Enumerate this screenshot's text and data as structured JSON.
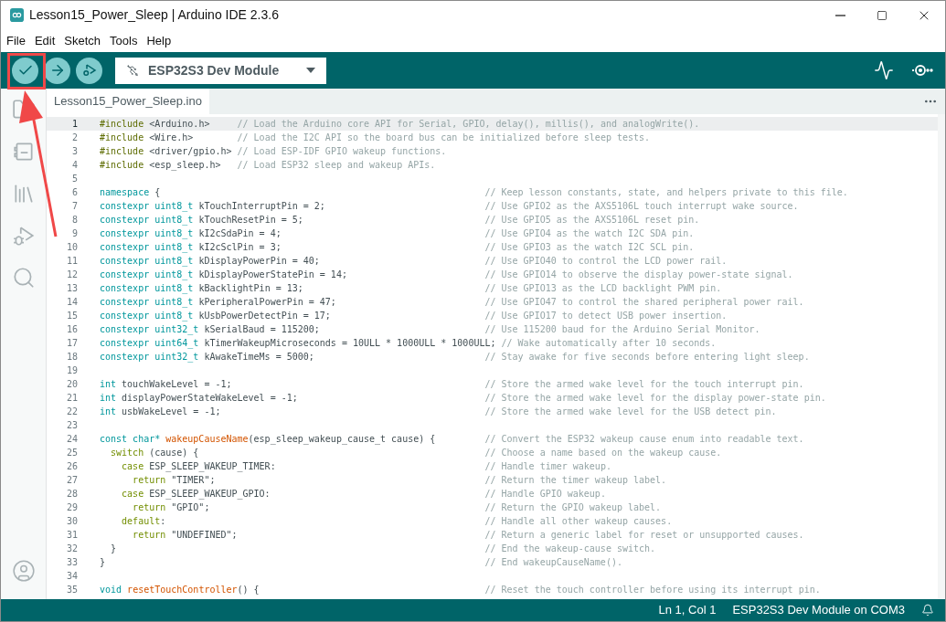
{
  "window": {
    "title": "Lesson15_Power_Sleep | Arduino IDE 2.3.6"
  },
  "menu": [
    "File",
    "Edit",
    "Sketch",
    "Tools",
    "Help"
  ],
  "toolbar": {
    "board": "ESP32S3 Dev Module"
  },
  "tabs": [
    {
      "label": "Lesson15_Power_Sleep.ino",
      "selected": true
    }
  ],
  "editor": {
    "lines": [
      {
        "n": "1",
        "current": true,
        "tokens": [
          {
            "kind": "pre",
            "text": "#include"
          },
          {
            "kind": "txt",
            "text": " <Arduino.h>     "
          },
          {
            "kind": "cmt",
            "text": "// Load the Arduino core API for Serial, GPIO, delay(), millis(), and analogWrite()."
          }
        ]
      },
      {
        "n": "2",
        "current": false,
        "tokens": [
          {
            "kind": "pre",
            "text": "#include"
          },
          {
            "kind": "txt",
            "text": " <Wire.h>        "
          },
          {
            "kind": "cmt",
            "text": "// Load the I2C API so the board bus can be initialized before sleep tests."
          }
        ]
      },
      {
        "n": "3",
        "current": false,
        "tokens": [
          {
            "kind": "pre",
            "text": "#include"
          },
          {
            "kind": "txt",
            "text": " <driver/gpio.h> "
          },
          {
            "kind": "cmt",
            "text": "// Load ESP-IDF GPIO wakeup functions."
          }
        ]
      },
      {
        "n": "4",
        "current": false,
        "tokens": [
          {
            "kind": "pre",
            "text": "#include"
          },
          {
            "kind": "txt",
            "text": " <esp_sleep.h>   "
          },
          {
            "kind": "cmt",
            "text": "// Load ESP32 sleep and wakeup APIs."
          }
        ]
      },
      {
        "n": "5",
        "current": false
      },
      {
        "n": "6",
        "current": false,
        "tokens": [
          {
            "kind": "kw",
            "text": "namespace"
          },
          {
            "kind": "txt",
            "text": " {                                                           "
          },
          {
            "kind": "cmt",
            "text": "// Keep lesson constants, state, and helpers private to this file."
          }
        ]
      },
      {
        "n": "7",
        "current": false,
        "tokens": [
          {
            "kind": "kw",
            "text": "constexpr uint8_t"
          },
          {
            "kind": "txt",
            "text": " kTouchInterruptPin = 2;                             "
          },
          {
            "kind": "cmt",
            "text": "// Use GPIO2 as the AXS5106L touch interrupt wake source."
          }
        ]
      },
      {
        "n": "8",
        "current": false,
        "tokens": [
          {
            "kind": "kw",
            "text": "constexpr uint8_t"
          },
          {
            "kind": "txt",
            "text": " kTouchResetPin = 5;                                 "
          },
          {
            "kind": "cmt",
            "text": "// Use GPIO5 as the AXS5106L reset pin."
          }
        ]
      },
      {
        "n": "9",
        "current": false,
        "tokens": [
          {
            "kind": "kw",
            "text": "constexpr uint8_t"
          },
          {
            "kind": "txt",
            "text": " kI2cSdaPin = 4;                                     "
          },
          {
            "kind": "cmt",
            "text": "// Use GPIO4 as the watch I2C SDA pin."
          }
        ]
      },
      {
        "n": "10",
        "current": false,
        "tokens": [
          {
            "kind": "kw",
            "text": "constexpr uint8_t"
          },
          {
            "kind": "txt",
            "text": " kI2cSclPin = 3;                                     "
          },
          {
            "kind": "cmt",
            "text": "// Use GPIO3 as the watch I2C SCL pin."
          }
        ]
      },
      {
        "n": "11",
        "current": false,
        "tokens": [
          {
            "kind": "kw",
            "text": "constexpr uint8_t"
          },
          {
            "kind": "txt",
            "text": " kDisplayPowerPin = 40;                              "
          },
          {
            "kind": "cmt",
            "text": "// Use GPIO40 to control the LCD power rail."
          }
        ]
      },
      {
        "n": "12",
        "current": false,
        "tokens": [
          {
            "kind": "kw",
            "text": "constexpr uint8_t"
          },
          {
            "kind": "txt",
            "text": " kDisplayPowerStatePin = 14;                         "
          },
          {
            "kind": "cmt",
            "text": "// Use GPIO14 to observe the display power-state signal."
          }
        ]
      },
      {
        "n": "13",
        "current": false,
        "tokens": [
          {
            "kind": "kw",
            "text": "constexpr uint8_t"
          },
          {
            "kind": "txt",
            "text": " kBacklightPin = 13;                                 "
          },
          {
            "kind": "cmt",
            "text": "// Use GPIO13 as the LCD backlight PWM pin."
          }
        ]
      },
      {
        "n": "14",
        "current": false,
        "tokens": [
          {
            "kind": "kw",
            "text": "constexpr uint8_t"
          },
          {
            "kind": "txt",
            "text": " kPeripheralPowerPin = 47;                           "
          },
          {
            "kind": "cmt",
            "text": "// Use GPIO47 to control the shared peripheral power rail."
          }
        ]
      },
      {
        "n": "15",
        "current": false,
        "tokens": [
          {
            "kind": "kw",
            "text": "constexpr uint8_t"
          },
          {
            "kind": "txt",
            "text": " kUsbPowerDetectPin = 17;                            "
          },
          {
            "kind": "cmt",
            "text": "// Use GPIO17 to detect USB power insertion."
          }
        ]
      },
      {
        "n": "16",
        "current": false,
        "tokens": [
          {
            "kind": "kw",
            "text": "constexpr uint32_t"
          },
          {
            "kind": "txt",
            "text": " kSerialBaud = 115200;                              "
          },
          {
            "kind": "cmt",
            "text": "// Use 115200 baud for the Arduino Serial Monitor."
          }
        ]
      },
      {
        "n": "17",
        "current": false,
        "tokens": [
          {
            "kind": "kw",
            "text": "constexpr uint64_t"
          },
          {
            "kind": "txt",
            "text": " kTimerWakeupMicroseconds = 10ULL * 1000ULL * 1000ULL; "
          },
          {
            "kind": "cmt",
            "text": "// Wake automatically after 10 seconds."
          }
        ]
      },
      {
        "n": "18",
        "current": false,
        "tokens": [
          {
            "kind": "kw",
            "text": "constexpr uint32_t"
          },
          {
            "kind": "txt",
            "text": " kAwakeTimeMs = 5000;                               "
          },
          {
            "kind": "cmt",
            "text": "// Stay awake for five seconds before entering light sleep."
          }
        ]
      },
      {
        "n": "19",
        "current": false
      },
      {
        "n": "20",
        "current": false,
        "tokens": [
          {
            "kind": "kw",
            "text": "int"
          },
          {
            "kind": "txt",
            "text": " touchWakeLevel = -1;                                              "
          },
          {
            "kind": "cmt",
            "text": "// Store the armed wake level for the touch interrupt pin."
          }
        ]
      },
      {
        "n": "21",
        "current": false,
        "tokens": [
          {
            "kind": "kw",
            "text": "int"
          },
          {
            "kind": "txt",
            "text": " displayPowerStateWakeLevel = -1;                                  "
          },
          {
            "kind": "cmt",
            "text": "// Store the armed wake level for the display power-state pin."
          }
        ]
      },
      {
        "n": "22",
        "current": false,
        "tokens": [
          {
            "kind": "kw",
            "text": "int"
          },
          {
            "kind": "txt",
            "text": " usbWakeLevel = -1;                                                "
          },
          {
            "kind": "cmt",
            "text": "// Store the armed wake level for the USB detect pin."
          }
        ]
      },
      {
        "n": "23",
        "current": false
      },
      {
        "n": "24",
        "current": false,
        "tokens": [
          {
            "kind": "kw",
            "text": "const char* "
          },
          {
            "kind": "fn",
            "text": "wakeupCauseName"
          },
          {
            "kind": "txt",
            "text": "(esp_sleep_wakeup_cause_t cause) {         "
          },
          {
            "kind": "cmt",
            "text": "// Convert the ESP32 wakeup cause enum into readable text."
          }
        ]
      },
      {
        "n": "25",
        "current": false,
        "tokens": [
          {
            "kind": "ctl",
            "text": "  switch"
          },
          {
            "kind": "txt",
            "text": " (cause) {                                                    "
          },
          {
            "kind": "cmt",
            "text": "// Choose a name based on the wakeup cause."
          }
        ]
      },
      {
        "n": "26",
        "current": false,
        "tokens": [
          {
            "kind": "ctl",
            "text": "    case"
          },
          {
            "kind": "txt",
            "text": " ESP_SLEEP_WAKEUP_TIMER:                                      "
          },
          {
            "kind": "cmt",
            "text": "// Handle timer wakeup."
          }
        ]
      },
      {
        "n": "27",
        "current": false,
        "tokens": [
          {
            "kind": "ctl",
            "text": "      return"
          },
          {
            "kind": "txt",
            "text": " \"TIMER\";                                                 "
          },
          {
            "kind": "cmt",
            "text": "// Return the timer wakeup label."
          }
        ]
      },
      {
        "n": "28",
        "current": false,
        "tokens": [
          {
            "kind": "ctl",
            "text": "    case"
          },
          {
            "kind": "txt",
            "text": " ESP_SLEEP_WAKEUP_GPIO:                                       "
          },
          {
            "kind": "cmt",
            "text": "// Handle GPIO wakeup."
          }
        ]
      },
      {
        "n": "29",
        "current": false,
        "tokens": [
          {
            "kind": "ctl",
            "text": "      return"
          },
          {
            "kind": "txt",
            "text": " \"GPIO\";                                                  "
          },
          {
            "kind": "cmt",
            "text": "// Return the GPIO wakeup label."
          }
        ]
      },
      {
        "n": "30",
        "current": false,
        "tokens": [
          {
            "kind": "ctl",
            "text": "    default"
          },
          {
            "kind": "txt",
            "text": ":                                                          "
          },
          {
            "kind": "cmt",
            "text": "// Handle all other wakeup causes."
          }
        ]
      },
      {
        "n": "31",
        "current": false,
        "tokens": [
          {
            "kind": "ctl",
            "text": "      return"
          },
          {
            "kind": "txt",
            "text": " \"UNDEFINED\";                                             "
          },
          {
            "kind": "cmt",
            "text": "// Return a generic label for reset or unsupported causes."
          }
        ]
      },
      {
        "n": "32",
        "current": false,
        "tokens": [
          {
            "kind": "txt",
            "text": "  }                                                                   "
          },
          {
            "kind": "cmt",
            "text": "// End the wakeup-cause switch."
          }
        ]
      },
      {
        "n": "33",
        "current": false,
        "tokens": [
          {
            "kind": "txt",
            "text": "}                                                                     "
          },
          {
            "kind": "cmt",
            "text": "// End wakeupCauseName()."
          }
        ]
      },
      {
        "n": "34",
        "current": false
      },
      {
        "n": "35",
        "current": false,
        "tokens": [
          {
            "kind": "kw",
            "text": "void "
          },
          {
            "kind": "fn",
            "text": "resetTouchController"
          },
          {
            "kind": "txt",
            "text": "() {                                         "
          },
          {
            "kind": "cmt",
            "text": "// Reset the touch controller before using its interrupt pin."
          }
        ]
      }
    ]
  },
  "status_bar": {
    "position": "Ln 1, Col 1",
    "board": "ESP32S3 Dev Module on COM3"
  }
}
